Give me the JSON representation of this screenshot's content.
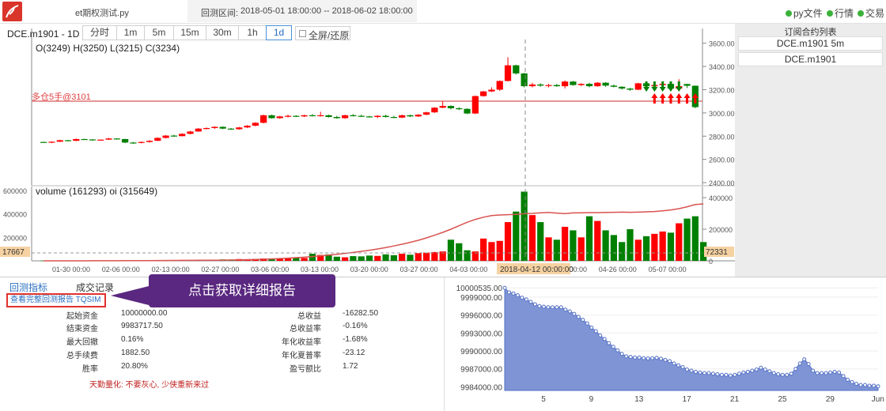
{
  "topbar": {
    "file_name": "et期权测试.py",
    "range_label": "回测区间:",
    "range_value": "2018-05-01 18:00:00 -- 2018-06-02 18:00:00",
    "status": [
      {
        "label": "py文件"
      },
      {
        "label": "行情"
      },
      {
        "label": "交易"
      }
    ],
    "status_color": "#3bb33b"
  },
  "chart_toolbar": {
    "symbol_label": "DCE.m1901 - 1D",
    "periods": [
      "分时",
      "1m",
      "5m",
      "15m",
      "30m",
      "1h",
      "1d"
    ],
    "active_period": "1d",
    "fullscreen_label": "全屏/还原"
  },
  "right_panel": {
    "title": "订阅合约列表",
    "items": [
      "DCE.m1901 5m",
      "DCE.m1901"
    ]
  },
  "colors": {
    "up": "#ff0000",
    "down": "#008000",
    "ma_line": "#d9534f",
    "equity_fill": "#7088d0",
    "accent": "#2a6fc0",
    "tooltip_bg": "#5a2880"
  },
  "chart_data": [
    {
      "type": "candlestick",
      "ohlc_label": "O(3249) H(3250) L(3215) C(3234)",
      "y_ticks": [
        "3600.00",
        "3400.00",
        "3200.00",
        "3000.00",
        "2800.00",
        "2600.00",
        "2400.00"
      ],
      "ylim": [
        2380,
        3700
      ],
      "position_line": {
        "label": "多仓5手@3101",
        "value": 3101
      },
      "candles": [
        [
          2750,
          2752,
          2745,
          2748
        ],
        [
          2748,
          2755,
          2740,
          2752
        ],
        [
          2752,
          2770,
          2750,
          2765
        ],
        [
          2765,
          2768,
          2755,
          2760
        ],
        [
          2760,
          2780,
          2758,
          2775
        ],
        [
          2775,
          2778,
          2770,
          2772
        ],
        [
          2772,
          2774,
          2760,
          2768
        ],
        [
          2768,
          2772,
          2764,
          2770
        ],
        [
          2770,
          2785,
          2768,
          2780
        ],
        [
          2780,
          2782,
          2770,
          2775
        ],
        [
          2775,
          2778,
          2740,
          2745
        ],
        [
          2745,
          2750,
          2735,
          2742
        ],
        [
          2742,
          2755,
          2738,
          2750
        ],
        [
          2750,
          2765,
          2745,
          2760
        ],
        [
          2760,
          2790,
          2758,
          2785
        ],
        [
          2785,
          2810,
          2780,
          2805
        ],
        [
          2805,
          2812,
          2795,
          2800
        ],
        [
          2800,
          2825,
          2798,
          2820
        ],
        [
          2820,
          2845,
          2815,
          2840
        ],
        [
          2840,
          2870,
          2838,
          2865
        ],
        [
          2865,
          2875,
          2858,
          2870
        ],
        [
          2870,
          2885,
          2862,
          2880
        ],
        [
          2880,
          2885,
          2860,
          2865
        ],
        [
          2865,
          2870,
          2855,
          2860
        ],
        [
          2860,
          2880,
          2855,
          2875
        ],
        [
          2875,
          2895,
          2870,
          2890
        ],
        [
          2890,
          2920,
          2885,
          2915
        ],
        [
          2915,
          2985,
          2910,
          2980
        ],
        [
          2980,
          2985,
          2950,
          2955
        ],
        [
          2955,
          2975,
          2950,
          2970
        ],
        [
          2970,
          2985,
          2960,
          2975
        ],
        [
          2975,
          2980,
          2965,
          2970
        ],
        [
          2970,
          2985,
          2965,
          2980
        ],
        [
          2980,
          2990,
          2970,
          2975
        ],
        [
          2975,
          3010,
          2970,
          2980
        ],
        [
          2980,
          2985,
          2960,
          2965
        ],
        [
          2965,
          2975,
          2950,
          2955
        ],
        [
          2955,
          2985,
          2950,
          2980
        ],
        [
          2980,
          2990,
          2970,
          2975
        ],
        [
          2975,
          2985,
          2965,
          2970
        ],
        [
          2970,
          2975,
          2960,
          2965
        ],
        [
          2965,
          2980,
          2955,
          2975
        ],
        [
          2975,
          2985,
          2960,
          2965
        ],
        [
          2965,
          2975,
          2955,
          2960
        ],
        [
          2960,
          2985,
          2955,
          2980
        ],
        [
          2980,
          2985,
          2965,
          2970
        ],
        [
          2970,
          2990,
          2965,
          2985
        ],
        [
          2985,
          3010,
          2980,
          3005
        ],
        [
          3005,
          3050,
          3000,
          3045
        ],
        [
          3045,
          3100,
          3040,
          3060
        ],
        [
          3060,
          3065,
          3030,
          3040
        ],
        [
          3040,
          3050,
          3025,
          3035
        ],
        [
          3035,
          3040,
          2990,
          2995
        ],
        [
          2995,
          3150,
          2990,
          3145
        ],
        [
          3145,
          3190,
          3140,
          3185
        ],
        [
          3185,
          3220,
          3180,
          3200
        ],
        [
          3200,
          3280,
          3190,
          3275
        ],
        [
          3275,
          3480,
          3270,
          3410
        ],
        [
          3410,
          3415,
          3330,
          3340
        ],
        [
          3340,
          3345,
          3220,
          3230
        ],
        [
          3230,
          3260,
          3220,
          3245
        ],
        [
          3245,
          3255,
          3225,
          3235
        ],
        [
          3235,
          3250,
          3220,
          3240
        ],
        [
          3240,
          3250,
          3225,
          3230
        ],
        [
          3230,
          3280,
          3210,
          3270
        ],
        [
          3270,
          3275,
          3235,
          3240
        ],
        [
          3240,
          3255,
          3230,
          3250
        ],
        [
          3250,
          3260,
          3220,
          3230
        ],
        [
          3230,
          3265,
          3225,
          3260
        ],
        [
          3260,
          3265,
          3225,
          3235
        ],
        [
          3235,
          3245,
          3220,
          3225
        ],
        [
          3225,
          3230,
          3200,
          3210
        ],
        [
          3210,
          3215,
          3190,
          3200
        ],
        [
          3200,
          3260,
          3195,
          3255
        ],
        [
          3255,
          3260,
          3220,
          3230
        ],
        [
          3230,
          3250,
          3215,
          3240
        ],
        [
          3240,
          3260,
          3230,
          3250
        ],
        [
          3250,
          3255,
          3200,
          3210
        ],
        [
          3210,
          3290,
          3200,
          3230
        ],
        [
          3249,
          3250,
          3215,
          3234
        ],
        [
          3234,
          3236,
          3040,
          3050
        ]
      ],
      "signals_up": [
        75,
        76,
        77,
        78,
        79,
        80
      ],
      "signals_down": [
        74,
        75,
        76,
        77,
        78
      ]
    },
    {
      "type": "bar",
      "label": "volume (161293) oi (315649)",
      "y_ticks_left": [
        "600000",
        "400000",
        "200000"
      ],
      "y_ticks_right": [
        "400000",
        "200000",
        "0"
      ],
      "ylim": [
        0,
        620000
      ],
      "volume_marker": "17667",
      "oi_marker": "72331",
      "x_ticks": [
        "01-30 00:00",
        "02-06 00:00",
        "02-13 00:00",
        "02-27 00:00",
        "03-06 00:00",
        "03-13 00:00",
        "03-20 00:00",
        "03-27 00:00",
        "04-03 00:00",
        "04-12 00:00:00",
        "04-19 00:00",
        "04-26 00:00",
        "05-07 00:00"
      ],
      "crosshair_label": "2018-04-12 00:00:00",
      "volumes": [
        1000,
        2500,
        1800,
        2200,
        3000,
        2800,
        4000,
        2600,
        3500,
        4200,
        3900,
        5000,
        4800,
        6200,
        5500,
        7000,
        6800,
        8000,
        7500,
        9000,
        8600,
        10000,
        12000,
        11000,
        15000,
        14000,
        16000,
        20000,
        18000,
        22000,
        21000,
        25000,
        24000,
        60000,
        50000,
        55000,
        35000,
        30000,
        40000,
        38000,
        45000,
        42000,
        55000,
        48000,
        60000,
        52000,
        65000,
        70000,
        75000,
        80000,
        180000,
        150000,
        90000,
        80000,
        190000,
        160000,
        170000,
        330000,
        420000,
        590000,
        390000,
        330000,
        200000,
        180000,
        290000,
        260000,
        200000,
        380000,
        340000,
        260000,
        220000,
        160000,
        270000,
        180000,
        210000,
        230000,
        250000,
        240000,
        320000,
        360000,
        380000,
        160000
      ],
      "oi": [
        100,
        100,
        100,
        100,
        200,
        200,
        300,
        400,
        500,
        600,
        800,
        1000,
        1200,
        1500,
        1800,
        2000,
        2300,
        2500,
        2800,
        3000,
        3400,
        3800,
        4200,
        5000,
        6000,
        7200,
        8500,
        10000,
        12000,
        14500,
        17000,
        20000,
        23000,
        27000,
        31000,
        36000,
        41000,
        47000,
        53000,
        60000,
        67000,
        75000,
        84000,
        94000,
        105000,
        117000,
        130000,
        145000,
        162000,
        180000,
        200000,
        222000,
        244000,
        262000,
        276000,
        286000,
        290000,
        292000,
        294000,
        298000,
        300000,
        304000,
        306000,
        302000,
        299000,
        303000,
        304000,
        305000,
        305000,
        306000,
        307000,
        308000,
        307000,
        308000,
        310000,
        312000,
        316000,
        322000,
        330000,
        342000,
        356000,
        360000
      ]
    },
    {
      "type": "area",
      "y_ticks": [
        "10000535.00",
        "9999000.00",
        "9996000.00",
        "9993000.00",
        "9990000.00",
        "9987000.00",
        "9984000.00"
      ],
      "x_ticks": [
        "5",
        "9",
        "13",
        "17",
        "21",
        "25",
        "29",
        "Jun"
      ],
      "ylim": [
        9983400,
        10000700
      ],
      "values": [
        10000535,
        9999800,
        9999600,
        9999300,
        9998900,
        9998600,
        9998200,
        9997800,
        9997500,
        9997400,
        9997300,
        9997300,
        9997300,
        9997300,
        9996900,
        9996600,
        9996200,
        9995700,
        9995200,
        9994600,
        9993900,
        9993300,
        9992600,
        9992000,
        9991300,
        9990700,
        9990100,
        9989500,
        9989100,
        9989000,
        9988900,
        9988900,
        9988800,
        9988750,
        9988800,
        9988850,
        9988700,
        9988500,
        9988300,
        9987900,
        9987600,
        9987300,
        9986900,
        9986700,
        9986500,
        9986400,
        9986300,
        9986300,
        9986200,
        9986100,
        9986000,
        9986000,
        9985900,
        9986000,
        9986200,
        9986400,
        9986500,
        9986700,
        9986900,
        9987200,
        9986900,
        9986600,
        9986300,
        9986100,
        9986000,
        9986000,
        9986200,
        9987000,
        9987900,
        9988600,
        9987800,
        9986700,
        9986300,
        9986300,
        9986300,
        9986400,
        9986500,
        9986400,
        9985800,
        9985200,
        9984800,
        9984500,
        9984300,
        9984300,
        9984200,
        9984200,
        9984100
      ]
    }
  ],
  "metrics": {
    "tab_metrics": "回测指标",
    "tab_trades": "成交记录",
    "report_link": "查看完整回测报告 TQSIM",
    "tooltip": "点击获取详细报告",
    "left": [
      {
        "label": "起始资金",
        "value": "10000000.00"
      },
      {
        "label": "结束资金",
        "value": "9983717.50"
      },
      {
        "label": "最大回撤",
        "value": "0.16%"
      },
      {
        "label": "总手续费",
        "value": "1882.50"
      },
      {
        "label": "胜率",
        "value": "20.80%"
      }
    ],
    "right": [
      {
        "label": "总收益",
        "value": "-16282.50"
      },
      {
        "label": "总收益率",
        "value": "-0.16%"
      },
      {
        "label": "年化收益率",
        "value": "-1.68%"
      },
      {
        "label": "年化夏普率",
        "value": "-23.12"
      },
      {
        "label": "盈亏额比",
        "value": "1.72"
      }
    ],
    "slogan": "天勤量化: 不要灰心, 少侠重新来过"
  }
}
